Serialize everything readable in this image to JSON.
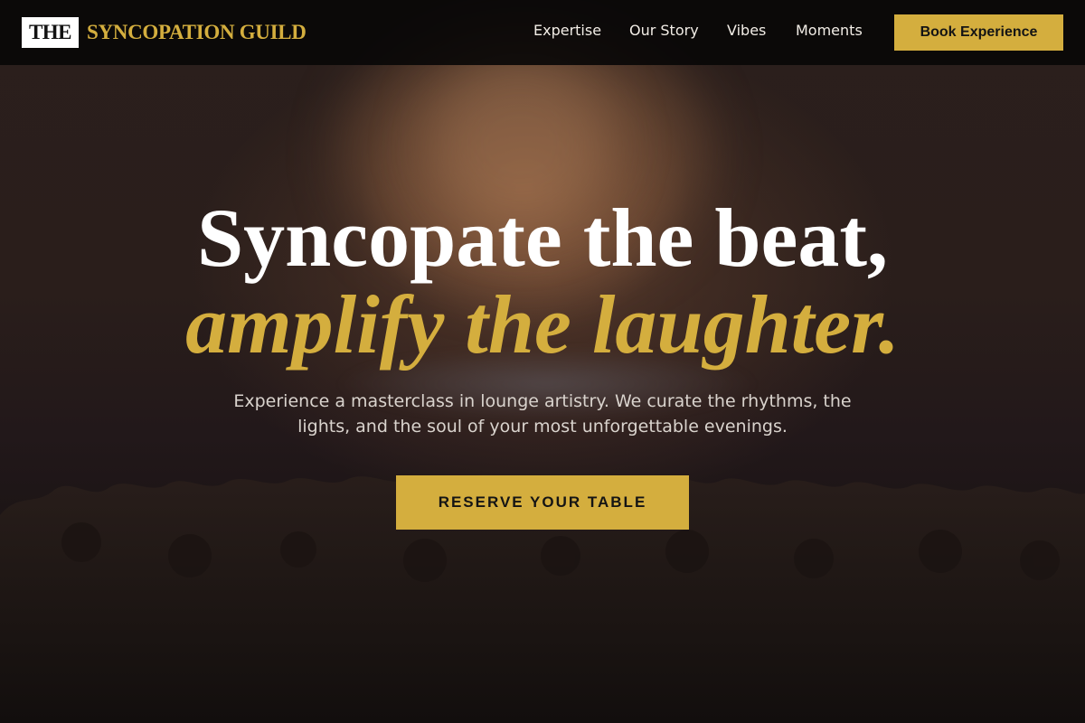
{
  "brand": {
    "logo_box": "THE",
    "logo_text": "SYNCOPATION GUILD",
    "accent_color": "#d4ae3e"
  },
  "nav": {
    "links": [
      {
        "label": "Expertise"
      },
      {
        "label": "Our Story"
      },
      {
        "label": "Vibes"
      },
      {
        "label": "Moments"
      }
    ],
    "cta_label": "Book Experience"
  },
  "hero": {
    "headline_line1": "Syncopate the beat,",
    "headline_line2": "amplify the laughter.",
    "subtitle": "Experience a masterclass in lounge artistry. We curate the rhythms, the lights, and the soul of your most unforgettable evenings.",
    "cta_label": "RESERVE YOUR TABLE"
  }
}
